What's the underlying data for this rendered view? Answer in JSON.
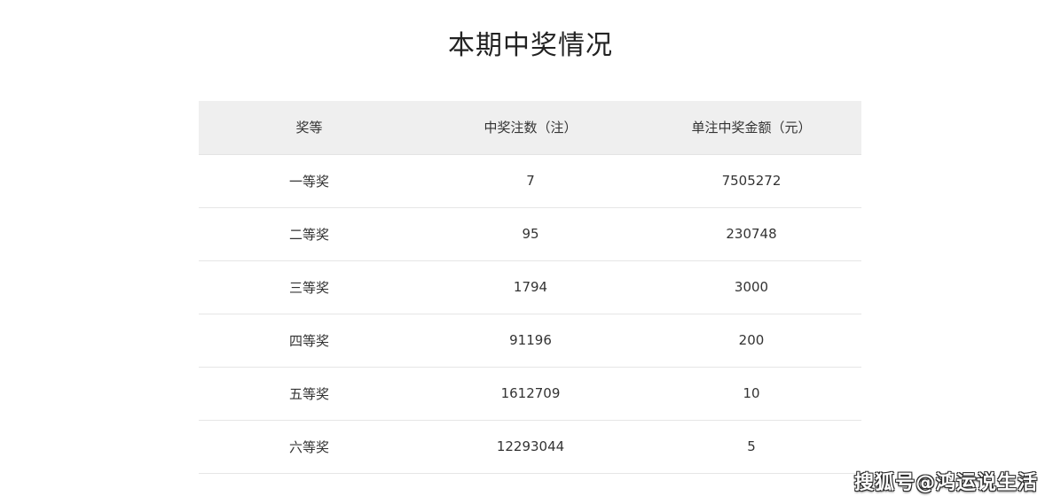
{
  "title": "本期中奖情况",
  "table": {
    "headers": [
      "奖等",
      "中奖注数（注）",
      "单注中奖金额（元）"
    ],
    "rows": [
      [
        "一等奖",
        "7",
        "7505272"
      ],
      [
        "二等奖",
        "95",
        "230748"
      ],
      [
        "三等奖",
        "1794",
        "3000"
      ],
      [
        "四等奖",
        "91196",
        "200"
      ],
      [
        "五等奖",
        "1612709",
        "10"
      ],
      [
        "六等奖",
        "12293044",
        "5"
      ]
    ]
  },
  "watermark": "搜狐号@鸿运说生活",
  "colors": {
    "header_bg": "#efefef",
    "row_border": "#e6e6e6",
    "text": "#333333"
  }
}
